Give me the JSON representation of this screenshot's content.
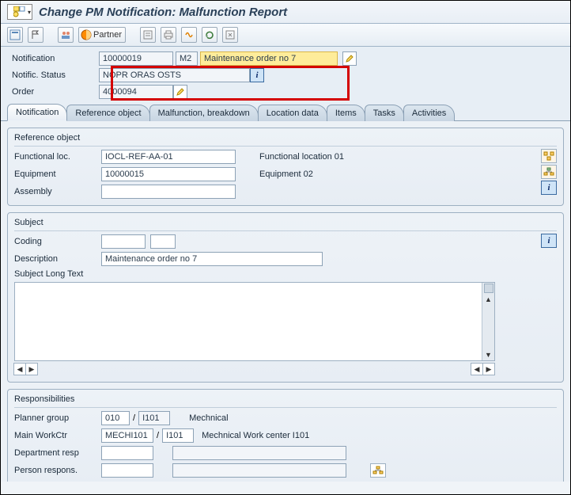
{
  "title": "Change PM Notification: Malfunction Report",
  "toolbar": {
    "partner_label": "Partner"
  },
  "header": {
    "notification_label": "Notification",
    "notification_value": "10000019",
    "notif_type": "M2",
    "notif_desc": "Maintenance order no 7",
    "status_label": "Notific. Status",
    "status_value": "NOPR ORAS OSTS",
    "order_label": "Order",
    "order_value": "4000094"
  },
  "tabs": [
    "Notification",
    "Reference object",
    "Malfunction, breakdown",
    "Location data",
    "Items",
    "Tasks",
    "Activities"
  ],
  "active_tab": 0,
  "reference_object": {
    "title": "Reference object",
    "functional_loc_label": "Functional loc.",
    "functional_loc_value": "IOCL-REF-AA-01",
    "functional_loc_desc": "Functional location 01",
    "equipment_label": "Equipment",
    "equipment_value": "10000015",
    "equipment_desc": "Equipment 02",
    "assembly_label": "Assembly",
    "assembly_value": ""
  },
  "subject": {
    "title": "Subject",
    "coding_label": "Coding",
    "coding_value1": "",
    "coding_value2": "",
    "description_label": "Description",
    "description_value": "Maintenance order no 7",
    "longtext_label": "Subject Long Text"
  },
  "responsibilities": {
    "title": "Responsibilities",
    "planner_group_label": "Planner group",
    "planner_group_val1": "010",
    "planner_group_val2": "I101",
    "planner_group_desc": "Mechnical",
    "main_workctr_label": "Main WorkCtr",
    "main_workctr_val1": "MECHI101",
    "main_workctr_val2": "I101",
    "main_workctr_desc": "Mechnical Work center I101",
    "department_resp_label": "Department resp",
    "department_resp_value": "",
    "person_respons_label": "Person respons.",
    "person_respons_value": ""
  }
}
